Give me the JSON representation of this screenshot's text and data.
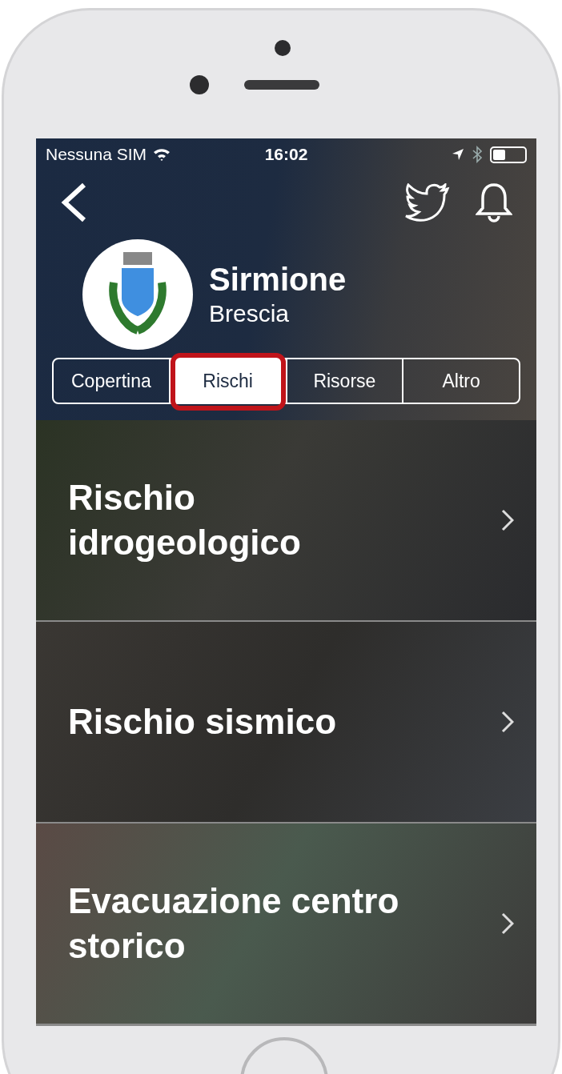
{
  "status_bar": {
    "carrier": "Nessuna SIM",
    "time": "16:02"
  },
  "header": {
    "title": "Sirmione",
    "subtitle": "Brescia"
  },
  "tabs": [
    {
      "label": "Copertina",
      "selected": false,
      "highlighted": false
    },
    {
      "label": "Rischi",
      "selected": true,
      "highlighted": true
    },
    {
      "label": "Risorse",
      "selected": false,
      "highlighted": false
    },
    {
      "label": "Altro",
      "selected": false,
      "highlighted": false
    }
  ],
  "cards": [
    {
      "title": "Rischio idrogeologico"
    },
    {
      "title": "Rischio sismico"
    },
    {
      "title": "Evacuazione centro storico"
    }
  ]
}
